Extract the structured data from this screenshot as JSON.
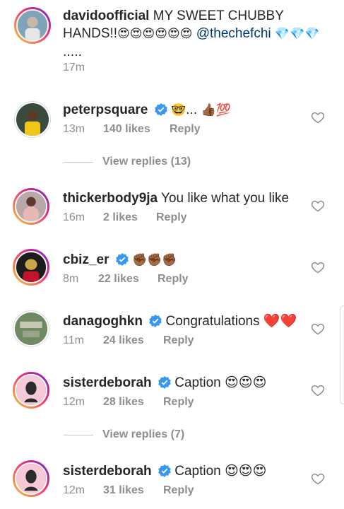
{
  "caption": {
    "username": "davidoofficial",
    "text": "MY SWEET CHUBBY HANDS!!",
    "emojis": "😍😍😍😍😍😍",
    "mention": "@thechefchi",
    "trailing": "💎💎💎 .....",
    "time": "17m"
  },
  "comments": [
    {
      "username": "peterpsquare",
      "verified": true,
      "text": "🤓... 👍🏾💯",
      "time": "13m",
      "likes": "140 likes",
      "reply": "Reply"
    },
    {
      "username": "thickerbody9ja",
      "verified": false,
      "text": "You like what you like",
      "time": "16m",
      "likes": "2 likes",
      "reply": "Reply"
    },
    {
      "username": "cbiz_er",
      "verified": true,
      "text": "✊🏾✊🏾✊🏾",
      "time": "8m",
      "likes": "22 likes",
      "reply": "Reply"
    },
    {
      "username": "danagoghkn",
      "verified": true,
      "text": "Congratulations ❤️❤️",
      "time": "11m",
      "likes": "24 likes",
      "reply": "Reply"
    },
    {
      "username": "sisterdeborah",
      "verified": true,
      "text": "Caption 😍😍😍",
      "time": "12m",
      "likes": "28 likes",
      "reply": "Reply"
    },
    {
      "username": "sisterdeborah",
      "verified": true,
      "text": "Caption 😍😍😍",
      "time": "12m",
      "likes": "31 likes",
      "reply": "Reply"
    }
  ],
  "view_replies": [
    "View replies (13)",
    "View replies (7)"
  ],
  "colors": {
    "text": "#262626",
    "muted": "#8e8e8e",
    "verified": "#3897f0",
    "mention": "#00376b"
  }
}
